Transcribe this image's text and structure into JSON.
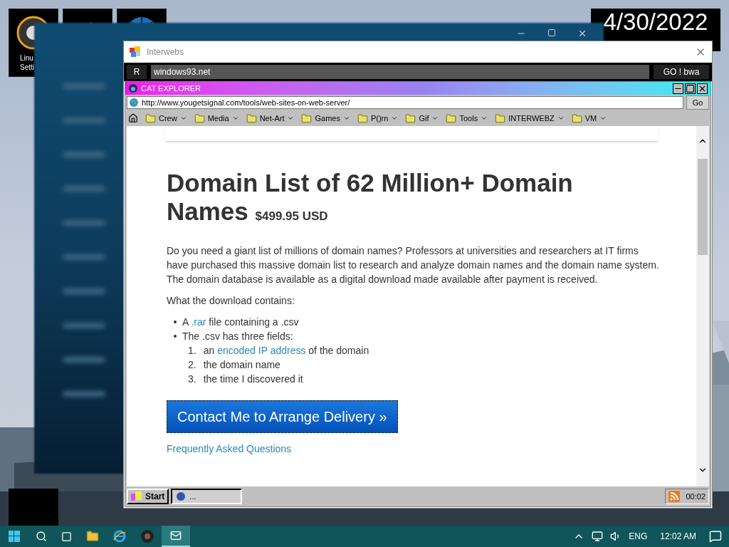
{
  "desktop_icons": [
    {
      "label": "Linu\nSetti",
      "kind": "logo"
    },
    {
      "kind": "chart"
    },
    {
      "kind": "globe"
    }
  ],
  "clock": {
    "date": "4/30/2022"
  },
  "interwebs": {
    "title": "Interwebs",
    "r_button": "R",
    "url": "windows93.net",
    "go_button": "GO ! bwa"
  },
  "cat_explorer": {
    "title": "CAT EXPLORER",
    "url": "http://www.yougetsignal.com/tools/web-sites-on-web-server/",
    "go_button": "Go",
    "bookmarks": [
      "Crew",
      "Media",
      "Net-Art",
      "Games",
      "P()rn",
      "Gif",
      "Tools",
      "INTERWEBZ",
      "VM"
    ]
  },
  "page": {
    "heading": "Domain List of 62 Million+ Domain Names",
    "price": "$499.95 USD",
    "intro": "Do you need a giant list of millions of domain names? Professors at universities and researchers at IT firms have purchased this massive domain list to research and analyze domain names and the domain name system. The domain database is available as a digital download made available after payment is received.",
    "contents_label": "What the download contains:",
    "bullets": [
      {
        "parts": [
          {
            "text": "A ",
            "kind": "text"
          },
          {
            "text": ".rar",
            "kind": "link"
          },
          {
            "text": " file containing a .csv",
            "kind": "text"
          }
        ]
      },
      {
        "parts": [
          {
            "text": "The .csv has three fields:",
            "kind": "text"
          }
        ],
        "children": [
          {
            "number": "1.",
            "parts": [
              {
                "text": "an ",
                "kind": "text"
              },
              {
                "text": "encoded IP address",
                "kind": "link"
              },
              {
                "text": " of the domain",
                "kind": "text"
              }
            ]
          },
          {
            "number": "2.",
            "parts": [
              {
                "text": "the domain name",
                "kind": "text"
              }
            ]
          },
          {
            "number": "3.",
            "parts": [
              {
                "text": "the time I discovered it",
                "kind": "text"
              }
            ]
          }
        ]
      }
    ],
    "cta_button": "Contact Me to Arrange Delivery »",
    "faq_link": "Frequently Asked Questions"
  },
  "inner_taskbar": {
    "start": "Start",
    "task": "...",
    "time": "00:02"
  },
  "taskbar": {
    "language": "ENG",
    "time": "12:02 AM"
  }
}
